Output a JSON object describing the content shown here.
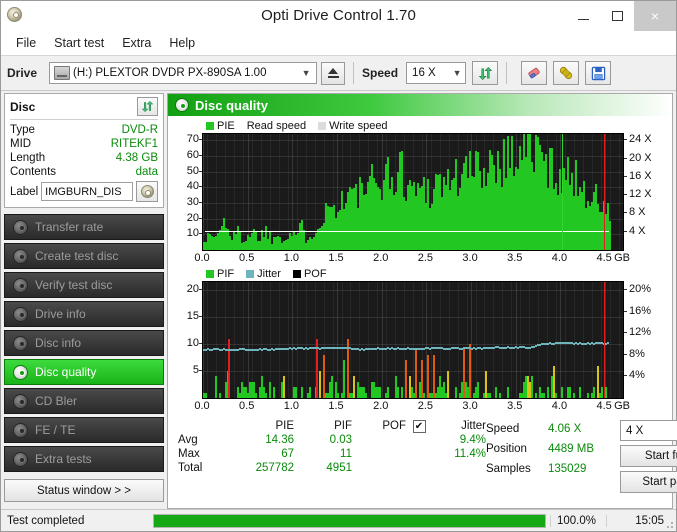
{
  "window": {
    "title": "Opti Drive Control 1.70",
    "app_icon": "disc-icon",
    "minimize": "–",
    "maximize": "□",
    "close": "×"
  },
  "menu": {
    "items": [
      "File",
      "Start test",
      "Extra",
      "Help"
    ]
  },
  "toolbar": {
    "drive_label": "Drive",
    "drive_value": "(H:)  PLEXTOR DVDR  PX-890SA 1.00",
    "eject_icon": "eject-icon",
    "speed_label": "Speed",
    "speed_value": "16 X",
    "refresh_icon": "refresh-arrows-icon",
    "erase_icon": "eraser-icon",
    "tools_icon": "plug-icon",
    "save_icon": "save-floppy-icon"
  },
  "disc": {
    "heading": "Disc",
    "refresh_icon": "refresh-arrows-icon",
    "rows": [
      {
        "key": "Type",
        "value": "DVD-R"
      },
      {
        "key": "MID",
        "value": "RITEKF1"
      },
      {
        "key": "Length",
        "value": "4.38 GB"
      },
      {
        "key": "Contents",
        "value": "data"
      }
    ],
    "label_key": "Label",
    "label_value": "IMGBURN_DIS",
    "label_button_icon": "disc-icon"
  },
  "sidebar": {
    "items": [
      {
        "label": "Transfer rate",
        "icon": "disc-icon",
        "active": false
      },
      {
        "label": "Create test disc",
        "icon": "disc-write-icon",
        "active": false
      },
      {
        "label": "Verify test disc",
        "icon": "disc-check-icon",
        "active": false
      },
      {
        "label": "Drive info",
        "icon": "drive-icon",
        "active": false
      },
      {
        "label": "Disc info",
        "icon": "disc-info-icon",
        "active": false
      },
      {
        "label": "Disc quality",
        "icon": "disc-quality-icon",
        "active": true
      },
      {
        "label": "CD Bler",
        "icon": "disc-icon",
        "active": false
      },
      {
        "label": "FE / TE",
        "icon": "disc-icon",
        "active": false
      },
      {
        "label": "Extra tests",
        "icon": "disc-icon",
        "active": false
      }
    ],
    "status_window": "Status window > >"
  },
  "main": {
    "header_title": "Disc quality",
    "header_icon": "disc-quality-icon"
  },
  "colors": {
    "pie": "#22c722",
    "pif": "#22c722",
    "pof": "#000000",
    "jitter": "#6fb5bd",
    "read_speed": "#ffffff",
    "write_speed": "#dcdcdc",
    "accent_green": "#12a012",
    "value_green": "#0a8a0a",
    "plot_bg": "#1a1a1a",
    "marker_red": "#e02020"
  },
  "stats": {
    "columns": [
      "PIE",
      "PIF",
      "POF",
      "Jitter"
    ],
    "jitter_checked": true,
    "jitter_check_glyph": "✔",
    "rows": [
      {
        "label": "Avg",
        "pie": "14.36",
        "pif": "0.03",
        "pof": "",
        "jitter": "9.4%"
      },
      {
        "label": "Max",
        "pie": "67",
        "pif": "11",
        "pof": "",
        "jitter": "11.4%"
      },
      {
        "label": "Total",
        "pie": "257782",
        "pif": "4951",
        "pof": "",
        "jitter": ""
      }
    ],
    "speed_label": "Speed",
    "speed_value": "4.06 X",
    "position_label": "Position",
    "position_value": "4489 MB",
    "samples_label": "Samples",
    "samples_value": "135029",
    "speed_select": "4 X",
    "start_full": "Start full",
    "start_part": "Start part"
  },
  "statusbar": {
    "text": "Test completed",
    "progress_pct": "100.0%",
    "progress_value": 100,
    "time": "15:05"
  },
  "chart_data": [
    {
      "type": "area",
      "title": "PIE / Read speed",
      "legend": [
        {
          "label": "PIE",
          "color": "#22c722",
          "swatch": true
        },
        {
          "label": "Read speed",
          "color": "#ffffff",
          "swatch": false
        },
        {
          "label": "Write speed",
          "color": "#dcdcdc",
          "swatch": true
        }
      ],
      "xlabel": "GB",
      "xlim": [
        0,
        4.7
      ],
      "xticks": [
        0.0,
        0.5,
        1.0,
        1.5,
        2.0,
        2.5,
        3.0,
        3.5,
        4.0,
        4.5
      ],
      "xticklabels": [
        "0.0",
        "0.5",
        "1.0",
        "1.5",
        "2.0",
        "2.5",
        "3.0",
        "3.5",
        "4.0",
        "4.5"
      ],
      "x_unit_label": "GB",
      "ylabel": "PIE",
      "ylim": [
        0,
        74
      ],
      "yticks": [
        10,
        20,
        30,
        40,
        50,
        60,
        70
      ],
      "y2label": "Speed",
      "y2lim": [
        0,
        25.4
      ],
      "y2ticks": [
        4,
        8,
        12,
        16,
        20,
        24
      ],
      "y2ticklabels": [
        "4 X",
        "8 X",
        "12 X",
        "16 X",
        "20 X",
        "24 X"
      ],
      "series": [
        {
          "name": "PIE",
          "color": "#22c722",
          "x": [
            0.0,
            0.05,
            0.1,
            0.15,
            0.2,
            0.25,
            0.3,
            0.35,
            0.4,
            0.45,
            0.5,
            0.55,
            0.6,
            0.65,
            0.7,
            0.75,
            0.8,
            0.85,
            0.9,
            0.95,
            1.0,
            1.05,
            1.1,
            1.15,
            1.2,
            1.25,
            1.3,
            1.35,
            1.4,
            1.45,
            1.5,
            1.55,
            1.6,
            1.65,
            1.7,
            1.75,
            1.8,
            1.85,
            1.9,
            1.95,
            2.0,
            2.05,
            2.1,
            2.15,
            2.2,
            2.25,
            2.3,
            2.35,
            2.4,
            2.45,
            2.5,
            2.55,
            2.6,
            2.65,
            2.7,
            2.75,
            2.8,
            2.85,
            2.9,
            2.95,
            3.0,
            3.05,
            3.1,
            3.15,
            3.2,
            3.25,
            3.3,
            3.35,
            3.4,
            3.45,
            3.5,
            3.55,
            3.6,
            3.65,
            3.7,
            3.75,
            3.8,
            3.85,
            3.9,
            3.95,
            4.0,
            4.05,
            4.1,
            4.15,
            4.2,
            4.25,
            4.3,
            4.35,
            4.4,
            4.45,
            4.5
          ],
          "values": [
            8,
            7,
            9,
            8,
            12,
            19,
            9,
            8,
            10,
            7,
            9,
            11,
            8,
            9,
            12,
            8,
            7,
            10,
            9,
            8,
            11,
            9,
            13,
            8,
            10,
            12,
            16,
            22,
            26,
            24,
            30,
            28,
            33,
            36,
            31,
            35,
            38,
            34,
            41,
            37,
            44,
            48,
            40,
            43,
            50,
            45,
            39,
            37,
            35,
            41,
            38,
            36,
            40,
            44,
            39,
            42,
            46,
            43,
            48,
            45,
            50,
            47,
            52,
            49,
            55,
            51,
            57,
            54,
            60,
            56,
            61,
            58,
            64,
            67,
            62,
            58,
            55,
            52,
            49,
            46,
            50,
            44,
            42,
            47,
            40,
            38,
            35,
            33,
            30,
            28,
            22
          ]
        },
        {
          "name": "Read speed",
          "color": "#ffffff",
          "x": [
            0.0,
            0.5,
            1.0,
            1.5,
            2.0,
            2.5,
            3.0,
            3.5,
            4.0,
            4.5
          ],
          "values": [
            4.06,
            4.06,
            4.06,
            4.06,
            4.06,
            4.06,
            4.06,
            4.06,
            4.06,
            4.06
          ]
        }
      ]
    },
    {
      "type": "bar",
      "title": "PIF / Jitter / POF",
      "legend": [
        {
          "label": "PIF",
          "color": "#22c722",
          "swatch": true
        },
        {
          "label": "Jitter",
          "color": "#6fb5bd",
          "swatch": true
        },
        {
          "label": "POF",
          "color": "#000000",
          "swatch": true
        }
      ],
      "xlabel": "GB",
      "xlim": [
        0,
        4.7
      ],
      "xticks": [
        0.0,
        0.5,
        1.0,
        1.5,
        2.0,
        2.5,
        3.0,
        3.5,
        4.0,
        4.5
      ],
      "xticklabels": [
        "0.0",
        "0.5",
        "1.0",
        "1.5",
        "2.0",
        "2.5",
        "3.0",
        "3.5",
        "4.0",
        "4.5"
      ],
      "x_unit_label": "GB",
      "ylabel": "PIF",
      "ylim": [
        0,
        21.5
      ],
      "yticks": [
        5,
        10,
        15,
        20
      ],
      "y2label": "Jitter",
      "y2lim": [
        0,
        21.5
      ],
      "y2ticks": [
        4,
        8,
        12,
        16,
        20
      ],
      "y2ticklabels": [
        "4%",
        "8%",
        "12%",
        "16%",
        "20%"
      ],
      "series": [
        {
          "name": "PIF",
          "color": "#22c722",
          "x": [
            0.0,
            0.05,
            0.1,
            0.15,
            0.2,
            0.25,
            0.3,
            0.35,
            0.4,
            0.45,
            0.5,
            0.55,
            0.6,
            0.65,
            0.7,
            0.75,
            0.8,
            0.85,
            0.9,
            0.95,
            1.0,
            1.05,
            1.1,
            1.15,
            1.2,
            1.25,
            1.3,
            1.35,
            1.4,
            1.45,
            1.5,
            1.55,
            1.6,
            1.65,
            1.7,
            1.75,
            1.8,
            1.85,
            1.9,
            1.95,
            2.0,
            2.05,
            2.1,
            2.15,
            2.2,
            2.25,
            2.3,
            2.35,
            2.4,
            2.45,
            2.5,
            2.55,
            2.6,
            2.65,
            2.7,
            2.75,
            2.8,
            2.85,
            2.9,
            2.95,
            3.0,
            3.05,
            3.1,
            3.15,
            3.2,
            3.25,
            3.3,
            3.35,
            3.4,
            3.45,
            3.5,
            3.55,
            3.6,
            3.65,
            3.7,
            3.75,
            3.8,
            3.85,
            3.9,
            3.95,
            4.0,
            4.05,
            4.1,
            4.15,
            4.2,
            4.25,
            4.3,
            4.35,
            4.4,
            4.45,
            4.5
          ],
          "values": [
            1,
            2,
            1,
            3,
            1,
            2,
            11,
            1,
            2,
            3,
            1,
            4,
            2,
            5,
            1,
            6,
            2,
            1,
            3,
            1,
            2,
            1,
            4,
            1,
            2,
            3,
            1,
            2,
            1,
            4,
            2,
            1,
            10,
            2,
            1,
            3,
            2,
            1,
            4,
            1,
            3,
            2,
            1,
            5,
            2,
            1,
            3,
            1,
            2,
            4,
            1,
            2,
            1,
            3,
            2,
            1,
            4,
            1,
            2,
            3,
            1,
            2,
            5,
            1,
            2,
            1,
            3,
            2,
            1,
            4,
            2,
            1,
            3,
            2,
            5,
            1,
            2,
            1,
            3,
            2,
            1,
            4,
            2,
            1,
            3,
            1,
            2,
            1,
            2,
            1,
            3
          ]
        },
        {
          "name": "Jitter",
          "color": "#6fb5bd",
          "x": [
            0.0,
            0.1,
            0.2,
            0.3,
            0.4,
            0.5,
            0.6,
            0.7,
            0.8,
            0.9,
            1.0,
            1.1,
            1.2,
            1.3,
            1.4,
            1.5,
            1.6,
            1.7,
            1.8,
            1.9,
            2.0,
            2.1,
            2.2,
            2.3,
            2.4,
            2.5,
            2.6,
            2.7,
            2.8,
            2.9,
            3.0,
            3.1,
            3.2,
            3.3,
            3.4,
            3.5,
            3.6,
            3.7,
            3.8,
            3.9,
            4.0,
            4.1,
            4.2,
            4.3,
            4.4,
            4.5
          ],
          "values": [
            9.2,
            9.1,
            9.2,
            9.1,
            9.2,
            9.2,
            9.1,
            9.2,
            9.2,
            9.3,
            9.4,
            9.4,
            9.4,
            9.4,
            9.4,
            9.4,
            9.4,
            9.3,
            9.2,
            9.3,
            9.3,
            9.3,
            9.3,
            9.3,
            9.3,
            9.4,
            9.4,
            9.4,
            9.4,
            9.4,
            9.4,
            9.4,
            9.4,
            9.5,
            9.5,
            9.5,
            9.5,
            9.6,
            10.2,
            10.3,
            10.3,
            10.3,
            10.3,
            10.3,
            10.3,
            10.3
          ]
        }
      ]
    }
  ]
}
